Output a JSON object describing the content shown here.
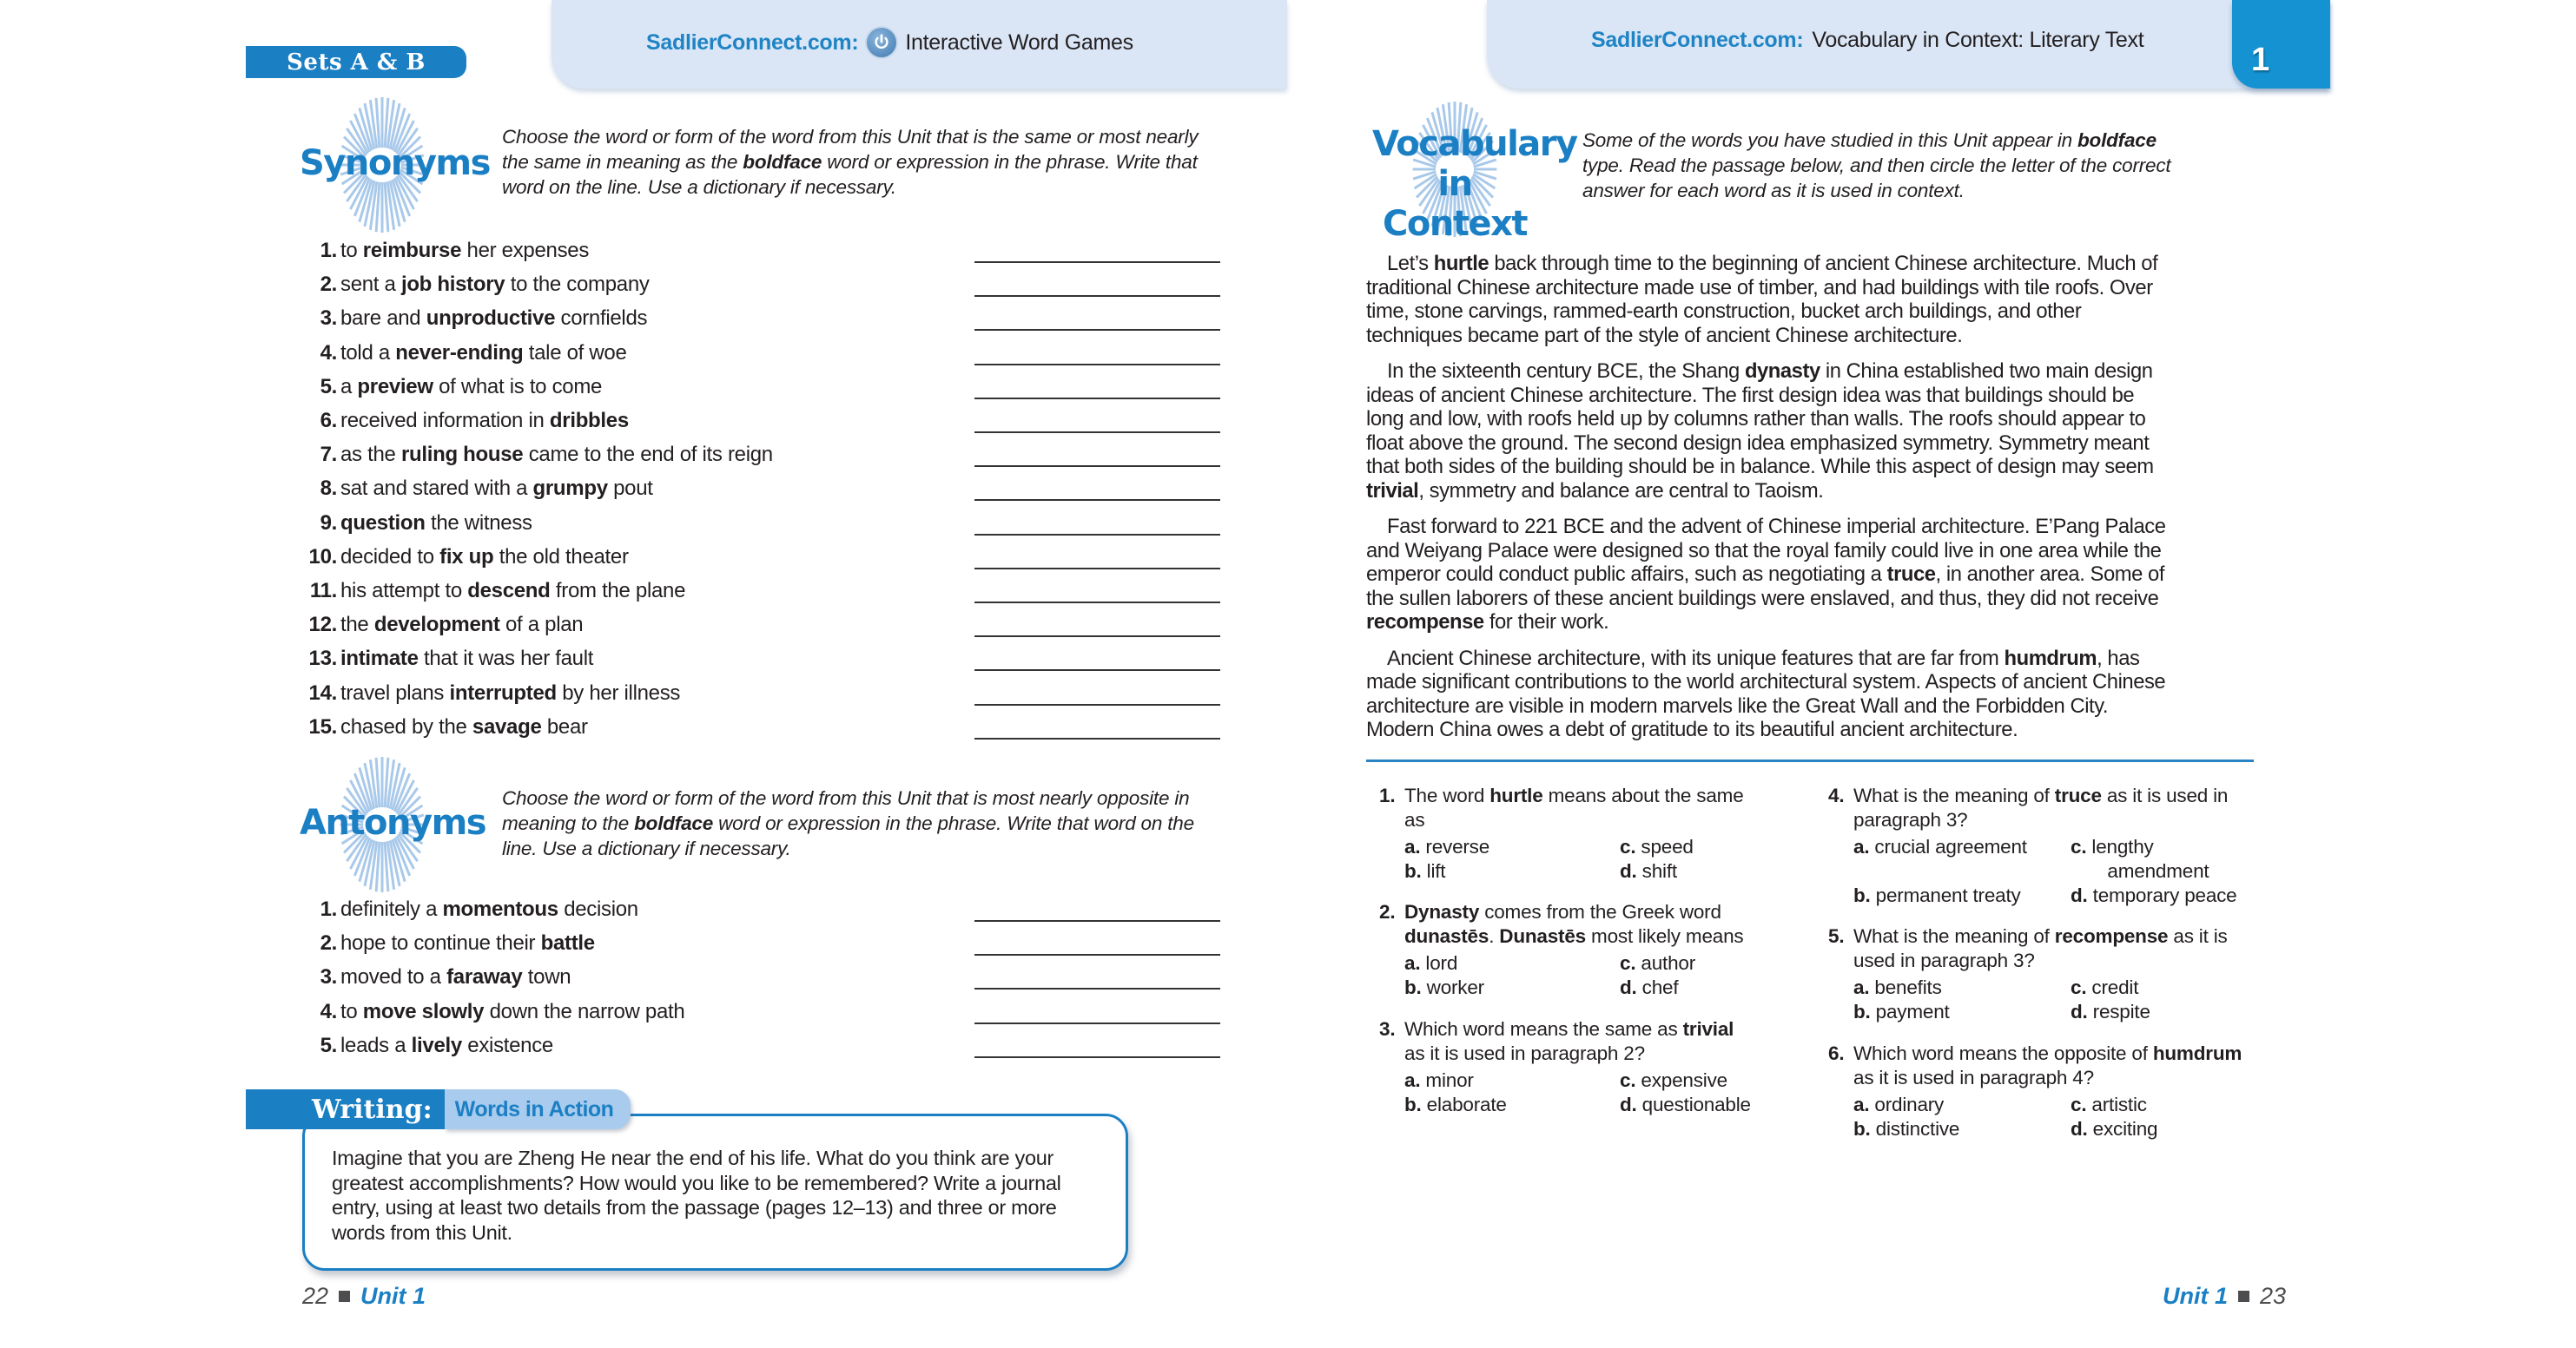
{
  "left_page": {
    "sets_badge": "Sets A & B",
    "header": {
      "site": "SadlierConnect.com:",
      "label": "Interactive Word Games",
      "icon": "power-icon"
    },
    "synonyms": {
      "title": "Synonyms",
      "instructions": [
        "Choose the word or form of the word from this Unit that is the same or most nearly the same in meaning as the ",
        "boldface",
        " word or expression in the phrase. Write that word on the line. Use a dictionary if necessary."
      ],
      "items": [
        {
          "num": "1.",
          "before": "to ",
          "bold": "reimburse",
          "after": " her expenses",
          "answer": ""
        },
        {
          "num": "2.",
          "before": "sent a ",
          "bold": "job history",
          "after": " to the company",
          "answer": ""
        },
        {
          "num": "3.",
          "before": "bare and ",
          "bold": "unproductive",
          "after": " cornfields",
          "answer": ""
        },
        {
          "num": "4.",
          "before": "told a ",
          "bold": "never-ending",
          "after": " tale of woe",
          "answer": ""
        },
        {
          "num": "5.",
          "before": "a ",
          "bold": "preview",
          "after": " of what is to come",
          "answer": ""
        },
        {
          "num": "6.",
          "before": "received information in ",
          "bold": "dribbles",
          "after": "",
          "answer": ""
        },
        {
          "num": "7.",
          "before": "as the ",
          "bold": "ruling house",
          "after": " came to the end of its reign",
          "answer": ""
        },
        {
          "num": "8.",
          "before": "sat and stared with a ",
          "bold": "grumpy",
          "after": " pout",
          "answer": ""
        },
        {
          "num": "9.",
          "before": "",
          "bold": "question",
          "after": " the witness",
          "answer": ""
        },
        {
          "num": "10.",
          "before": "decided to ",
          "bold": "fix up",
          "after": " the old theater",
          "answer": ""
        },
        {
          "num": "11.",
          "before": "his attempt to ",
          "bold": "descend",
          "after": " from the plane",
          "answer": ""
        },
        {
          "num": "12.",
          "before": "the ",
          "bold": "development",
          "after": " of a plan",
          "answer": ""
        },
        {
          "num": "13.",
          "before": "",
          "bold": "intimate",
          "after": " that it was her fault",
          "answer": ""
        },
        {
          "num": "14.",
          "before": "travel plans ",
          "bold": "interrupted",
          "after": " by her illness",
          "answer": ""
        },
        {
          "num": "15.",
          "before": "chased by the ",
          "bold": "savage",
          "after": " bear",
          "answer": ""
        }
      ]
    },
    "antonyms": {
      "title": "Antonyms",
      "instructions": [
        "Choose the word or form of the word from this Unit that is most nearly opposite in meaning to the ",
        "boldface",
        " word or expression in the phrase. Write that word on the line. Use a dictionary if necessary."
      ],
      "items": [
        {
          "num": "1.",
          "before": "definitely a ",
          "bold": "momentous",
          "after": " decision",
          "answer": ""
        },
        {
          "num": "2.",
          "before": "hope to continue their ",
          "bold": "battle",
          "after": "",
          "answer": ""
        },
        {
          "num": "3.",
          "before": "moved to a ",
          "bold": "faraway",
          "after": " town",
          "answer": ""
        },
        {
          "num": "4.",
          "before": "to ",
          "bold": "move slowly",
          "after": " down the narrow path",
          "answer": ""
        },
        {
          "num": "5.",
          "before": "leads a ",
          "bold": "lively",
          "after": " existence",
          "answer": ""
        }
      ]
    },
    "writing": {
      "label": "Writing:",
      "sublabel": "Words in Action",
      "prompt": "Imagine that you are Zheng He near the end of his life. What do you think are your greatest accomplishments? How would you like to be remembered? Write a journal entry, using at least two details from the passage (pages 12–13) and three or more words from this Unit."
    },
    "footer": {
      "page": "22",
      "unit": "Unit 1"
    }
  },
  "right_page": {
    "header": {
      "site": "SadlierConnect.com:",
      "label": "Vocabulary in Context: Literary Text"
    },
    "unit_tab": "1",
    "section": {
      "title_line1": "Vocabulary",
      "title_line2": "in Context",
      "instructions": [
        "Some of the words you have studied in this Unit appear in ",
        "boldface",
        " type. Read the passage below, and then circle the letter of the correct answer for each word as it is used in context."
      ]
    },
    "passage": [
      [
        "Let’s ",
        "hurtle",
        " back through time to the beginning of ancient Chinese architecture. Much of traditional Chinese architecture made use of timber, and had buildings with tile roofs. Over time, stone carvings, rammed-earth construction, bucket arch buildings, and other techniques became part of the style of ancient Chinese architecture."
      ],
      [
        "In the sixteenth century BCE, the Shang ",
        "dynasty",
        " in China established two main design ideas of ancient Chinese architecture. The first design idea was that buildings should be long and low, with roofs held up by columns rather than walls. The roofs should appear to float above the ground. The second design idea emphasized symmetry. Symmetry meant that both sides of the building should be in balance. While this aspect of design may seem ",
        "trivial",
        ", symmetry and balance are central to Taoism."
      ],
      [
        "Fast forward to 221 BCE and the advent of Chinese imperial architecture. E’Pang Palace and Weiyang Palace were designed so that the royal family could live in one area while the emperor could conduct public affairs, such as negotiating a ",
        "truce",
        ", in another area. Some of the sullen laborers of these ancient buildings were enslaved, and thus, they did not receive ",
        "recompense",
        " for their work."
      ],
      [
        "Ancient Chinese architecture, with its unique features that are far from ",
        "humdrum",
        ", has made significant contributions to the world architectural system. Aspects of ancient Chinese architecture are visible in modern marvels like the Great Wall and the Forbidden City. Modern China owes a debt of gratitude to its beautiful ancient architecture."
      ]
    ],
    "questions": [
      {
        "num": "1.",
        "stem": [
          [
            "The word ",
            false
          ],
          [
            "hurtle",
            true
          ],
          [
            " means about the same as",
            false
          ]
        ],
        "options": [
          {
            "letter": "a.",
            "text": "reverse"
          },
          {
            "letter": "b.",
            "text": "lift"
          },
          {
            "letter": "c.",
            "text": "speed"
          },
          {
            "letter": "d.",
            "text": "shift"
          }
        ]
      },
      {
        "num": "2.",
        "stem": [
          [
            "Dynasty",
            true
          ],
          [
            " comes from the Greek word ",
            false
          ],
          [
            "dunastēs",
            true
          ],
          [
            ". ",
            false
          ],
          [
            "Dunastēs",
            true
          ],
          [
            " most likely means",
            false
          ]
        ],
        "options": [
          {
            "letter": "a.",
            "text": "lord"
          },
          {
            "letter": "b.",
            "text": "worker"
          },
          {
            "letter": "c.",
            "text": "author"
          },
          {
            "letter": "d.",
            "text": "chef"
          }
        ]
      },
      {
        "num": "3.",
        "stem": [
          [
            "Which word means the same as ",
            false
          ],
          [
            "trivial",
            true
          ],
          [
            " as it is used in paragraph 2?",
            false
          ]
        ],
        "options": [
          {
            "letter": "a.",
            "text": "minor"
          },
          {
            "letter": "b.",
            "text": "elaborate"
          },
          {
            "letter": "c.",
            "text": "expensive"
          },
          {
            "letter": "d.",
            "text": "questionable"
          }
        ]
      },
      {
        "num": "4.",
        "stem": [
          [
            "What is the meaning of ",
            false
          ],
          [
            "truce",
            true
          ],
          [
            " as it is used in paragraph 3?",
            false
          ]
        ],
        "options": [
          {
            "letter": "a.",
            "text": "crucial agreement"
          },
          {
            "letter": "b.",
            "text": "permanent treaty"
          },
          {
            "letter": "c.",
            "text": "lengthy amendment"
          },
          {
            "letter": "d.",
            "text": "temporary peace"
          }
        ]
      },
      {
        "num": "5.",
        "stem": [
          [
            "What is the meaning of ",
            false
          ],
          [
            "recompense",
            true
          ],
          [
            " as it is used in paragraph 3?",
            false
          ]
        ],
        "options": [
          {
            "letter": "a.",
            "text": "benefits"
          },
          {
            "letter": "b.",
            "text": "payment"
          },
          {
            "letter": "c.",
            "text": "credit"
          },
          {
            "letter": "d.",
            "text": "respite"
          }
        ]
      },
      {
        "num": "6.",
        "stem": [
          [
            "Which word means the opposite of ",
            false
          ],
          [
            "humdrum",
            true
          ],
          [
            " as it is used in paragraph 4?",
            false
          ]
        ],
        "options": [
          {
            "letter": "a.",
            "text": "ordinary"
          },
          {
            "letter": "b.",
            "text": "distinctive"
          },
          {
            "letter": "c.",
            "text": "artistic"
          },
          {
            "letter": "d.",
            "text": "exciting"
          }
        ]
      }
    ],
    "footer": {
      "unit": "Unit 1",
      "page": "23"
    }
  },
  "colors": {
    "brand_blue": "#1b7fc4",
    "header_bg": "#dae6f6",
    "tab_blue": "#1492d2",
    "burst": "#a9c9ea"
  }
}
